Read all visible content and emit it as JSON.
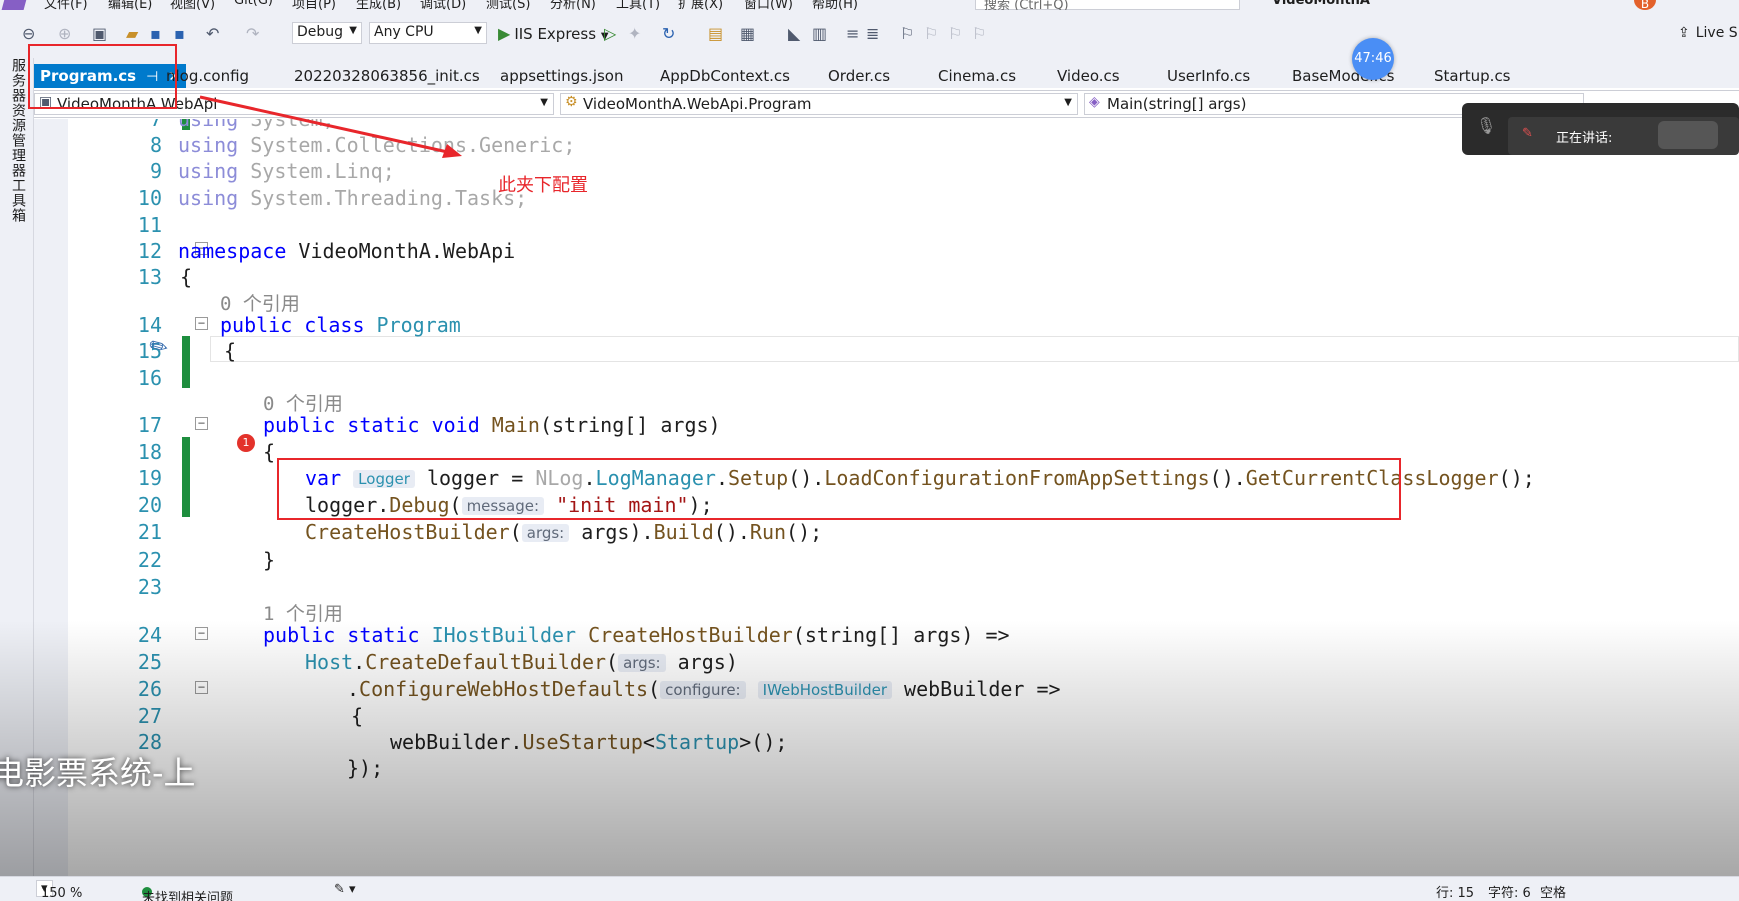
{
  "menubar": {
    "items": [
      "文件(F)",
      "编辑(E)",
      "视图(V)",
      "Git(G)",
      "项目(P)",
      "生成(B)",
      "调试(D)",
      "测试(S)",
      "分析(N)",
      "工具(T)",
      "扩展(X)",
      "窗口(W)",
      "帮助(H)"
    ],
    "search_placeholder": "搜索 (Ctrl+Q)",
    "window_title": "VideoMonthA",
    "avatar_letter": "B"
  },
  "toolbar": {
    "config": "Debug",
    "platform": "Any CPU",
    "run_label": "IIS Express",
    "live_share": "Live S"
  },
  "left_strip": {
    "server_explorer": "服务器资源管理器",
    "toolbox": "工具箱"
  },
  "tabs": [
    {
      "label": "Program.cs",
      "active": true
    },
    {
      "label": "nlog.config"
    },
    {
      "label": "20220328063856_init.cs"
    },
    {
      "label": "appsettings.json"
    },
    {
      "label": "AppDbContext.cs"
    },
    {
      "label": "Order.cs"
    },
    {
      "label": "Cinema.cs"
    },
    {
      "label": "Video.cs"
    },
    {
      "label": "UserInfo.cs"
    },
    {
      "label": "BaseModel.cs"
    },
    {
      "label": "Startup.cs"
    }
  ],
  "timer": "47:46",
  "navbar": {
    "project": "VideoMonthA.WebApi",
    "type": "VideoMonthA.WebApi.Program",
    "member": "Main(string[] args)"
  },
  "voice_overlay": {
    "speaking_label": "正在讲话:"
  },
  "editor": {
    "line_numbers": [
      "7",
      "8",
      "9",
      "10",
      "11",
      "12",
      "13",
      "14",
      "15",
      "16",
      "17",
      "18",
      "19",
      "20",
      "21",
      "22",
      "23",
      "24",
      "25",
      "26",
      "27",
      "28"
    ],
    "using_kw": "using",
    "using1": "System;",
    "using2": "System.Collections.Generic;",
    "using3": "System.Linq;",
    "using4": "System.Threading.Tasks;",
    "namespace_kw": "namespace",
    "namespace_name": "VideoMonthA.WebApi",
    "brace_open": "{",
    "brace_close": "}",
    "refs_0": "0 个引用",
    "refs_1": "1 个引用",
    "public_class": "public class",
    "class_name": "Program",
    "main_sig_kw": "public static void",
    "main_name": "Main",
    "main_params": "(string[] args)",
    "var_kw": "var",
    "hint_logger": "Logger",
    "logger_assign": "logger =",
    "nlog": "NLog",
    "logmanager": "LogManager",
    "setup": "Setup",
    "loadcfg": "LoadConfigurationFromAppSettings",
    "getlogger": "GetCurrentClassLogger",
    "logger": "logger",
    "debug": "Debug",
    "hint_message": "message:",
    "init_main": "\"init main\"",
    "createhost": "CreateHostBuilder",
    "hint_args": "args:",
    "args": "args",
    "build": "Build",
    "run": "Run",
    "public_static": "public static",
    "ihostbuilder": "IHostBuilder",
    "ch_params": "(string[] args) =>",
    "host": "Host",
    "createdefault": "CreateDefaultBuilder",
    "configure": "ConfigureWebHostDefaults",
    "hint_configure": "configure:",
    "hint_iweb": "IWebHostBuilder",
    "webbuilder_arrow": "webBuilder =>",
    "webbuilder": "webBuilder",
    "usestartup": "UseStartup",
    "startup": "Startup",
    "close_paren_semi": "});"
  },
  "annotation": {
    "text": "此夹下配置",
    "color": "#e8262b"
  },
  "error_badge": "1",
  "subtitle": "电影票系统-上",
  "statusbar": {
    "zoom": "150 %",
    "no_issues": "未找到相关问题",
    "line": "行: 15",
    "char": "字符: 6",
    "space": "空格"
  }
}
